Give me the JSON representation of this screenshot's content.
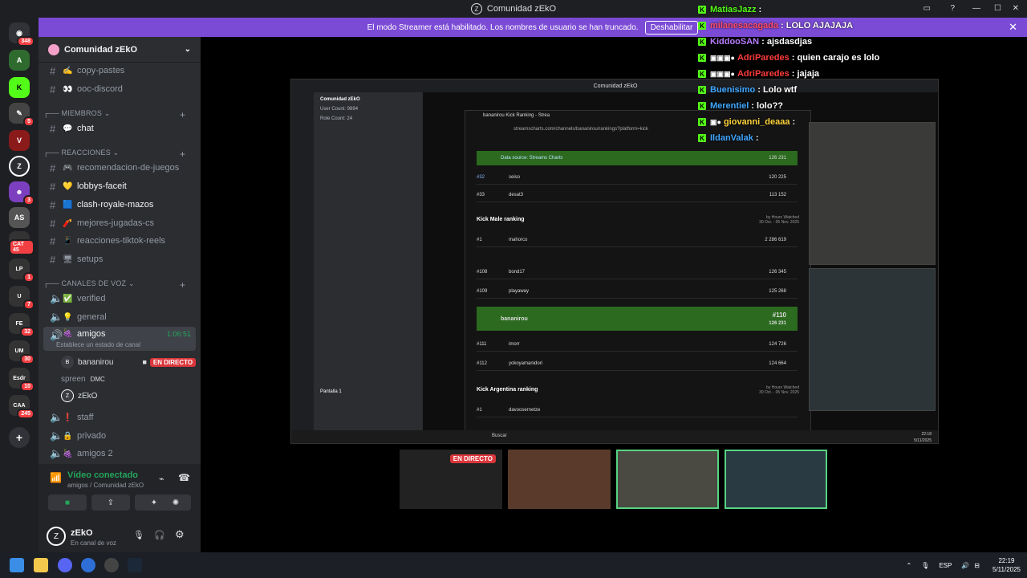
{
  "window": {
    "title": "Comunidad zEkO"
  },
  "banner": {
    "text": "El modo Streamer está habilitado. Los nombres de usuario se han truncado.",
    "button": "Deshabilitar"
  },
  "server": {
    "name": "Comunidad zEkO"
  },
  "channels": {
    "top": [
      {
        "emoji": "✍",
        "name": "copy-pastes"
      },
      {
        "emoji": "👀",
        "name": "ooc-discord"
      }
    ],
    "cat_miembros": "MIEMBROS",
    "chat": "chat",
    "cat_reacciones": "REACCIONES",
    "reacciones": [
      {
        "emoji": "🎮",
        "name": "recomendacion-de-juegos"
      },
      {
        "emoji": "💛",
        "name": "lobbys-faceit"
      },
      {
        "emoji": "🟦",
        "name": "clash-royale-mazos"
      },
      {
        "emoji": "🧨",
        "name": "mejores-jugadas-cs"
      },
      {
        "emoji": "📱",
        "name": "reacciones-tiktok-reels"
      },
      {
        "emoji": "🖥",
        "name": "setups"
      }
    ],
    "cat_voz": "CANALES DE VOZ",
    "voice": [
      {
        "emoji": "✅",
        "name": "verified"
      },
      {
        "emoji": "💡",
        "name": "general"
      }
    ],
    "amigos": {
      "name": "amigos",
      "time": "1:06:51",
      "status": "Establece un estado de canal"
    },
    "members": [
      {
        "name": "bananirou",
        "badge": "EN DIRECTO"
      },
      {
        "name": "spreen",
        "badge": "DMC"
      },
      {
        "name": "zEkO",
        "badge": ""
      }
    ],
    "voice_after": [
      {
        "emoji": "❗",
        "name": "staff"
      },
      {
        "emoji": "🔒",
        "name": "privado"
      },
      {
        "emoji": "🍇",
        "name": "amigos 2"
      }
    ]
  },
  "voice_panel": {
    "title": "Vídeo conectado",
    "sub": "amigos / Comunidad zEkO"
  },
  "user": {
    "name": "zEkO",
    "status": "En canal de voz"
  },
  "rail_badges": [
    "348",
    "5",
    "7",
    "3",
    "CAT 45",
    "1",
    "32",
    "30",
    "10",
    "245"
  ],
  "chat": [
    {
      "user": "MatiasJazz",
      "color": "#53fc18",
      "msg": ":"
    },
    {
      "user": "milanesacagada",
      "color": "#ff4d6d",
      "msg": ": LOLO AJAJAJA"
    },
    {
      "user": "KiddooSAN",
      "color": "#b77cff",
      "msg": ": ajsdasdjas"
    },
    {
      "user": "AdriParedes",
      "color": "#ff3b3b",
      "msg": ": quien carajo es lolo"
    },
    {
      "user": "AdriParedes",
      "color": "#ff3b3b",
      "msg": ": jajaja"
    },
    {
      "user": "Buenisimo",
      "color": "#3ea6ff",
      "msg": ": Lolo wtf"
    },
    {
      "user": "Merentiel",
      "color": "#3ea6ff",
      "msg": ": lolo??"
    },
    {
      "user": "giovanni_deaaa",
      "color": "#ffd43b",
      "msg": ":"
    },
    {
      "user": "IldanValak",
      "color": "#3ea6ff",
      "msg": ":"
    }
  ],
  "inner": {
    "title": "Comunidad zEkO",
    "user_count": "User Count: 9894",
    "role_count": "Role Count: 24",
    "browser_tab": "bananirou Kick Ranking - Strea",
    "url": "streamscharts.com/channels/bananirou/rankings?platform=kick",
    "section1": "Kick Male ranking",
    "section2": "Kick Argentina ranking",
    "period": "30 Oct. - 05 Nov. 2025",
    "hours": "by Hours Watched",
    "rows": [
      {
        "rank": "#32",
        "name": "seiso",
        "val": "120 225"
      },
      {
        "rank": "#33",
        "name": "desat3",
        "val": "113 152"
      },
      {
        "rank": "#1",
        "name": "mahorco",
        "val": "2 286 619"
      },
      {
        "rank": "#108",
        "name": "bond17",
        "val": "126 345"
      },
      {
        "rank": "#109",
        "name": "playaway",
        "val": "125 268"
      },
      {
        "rank": "#110",
        "name": "bananirou",
        "val": "126 231"
      },
      {
        "rank": "#111",
        "name": "imorr",
        "val": "124 726"
      },
      {
        "rank": "#112",
        "name": "yokoyamanidori",
        "val": "124 664"
      },
      {
        "rank": "#1",
        "name": "davoosernetze",
        "val": ""
      }
    ],
    "highlight_top": "126 231",
    "data_source": "Data source: Streams Charts",
    "clock": "22:18",
    "date": "5/11/2025",
    "search": "Buscar",
    "live": "EN DIRECTO",
    "screen_name": "Pantalla 1"
  },
  "taskbar": {
    "lang": "ESP",
    "time": "22:19",
    "date": "5/11/2025"
  }
}
